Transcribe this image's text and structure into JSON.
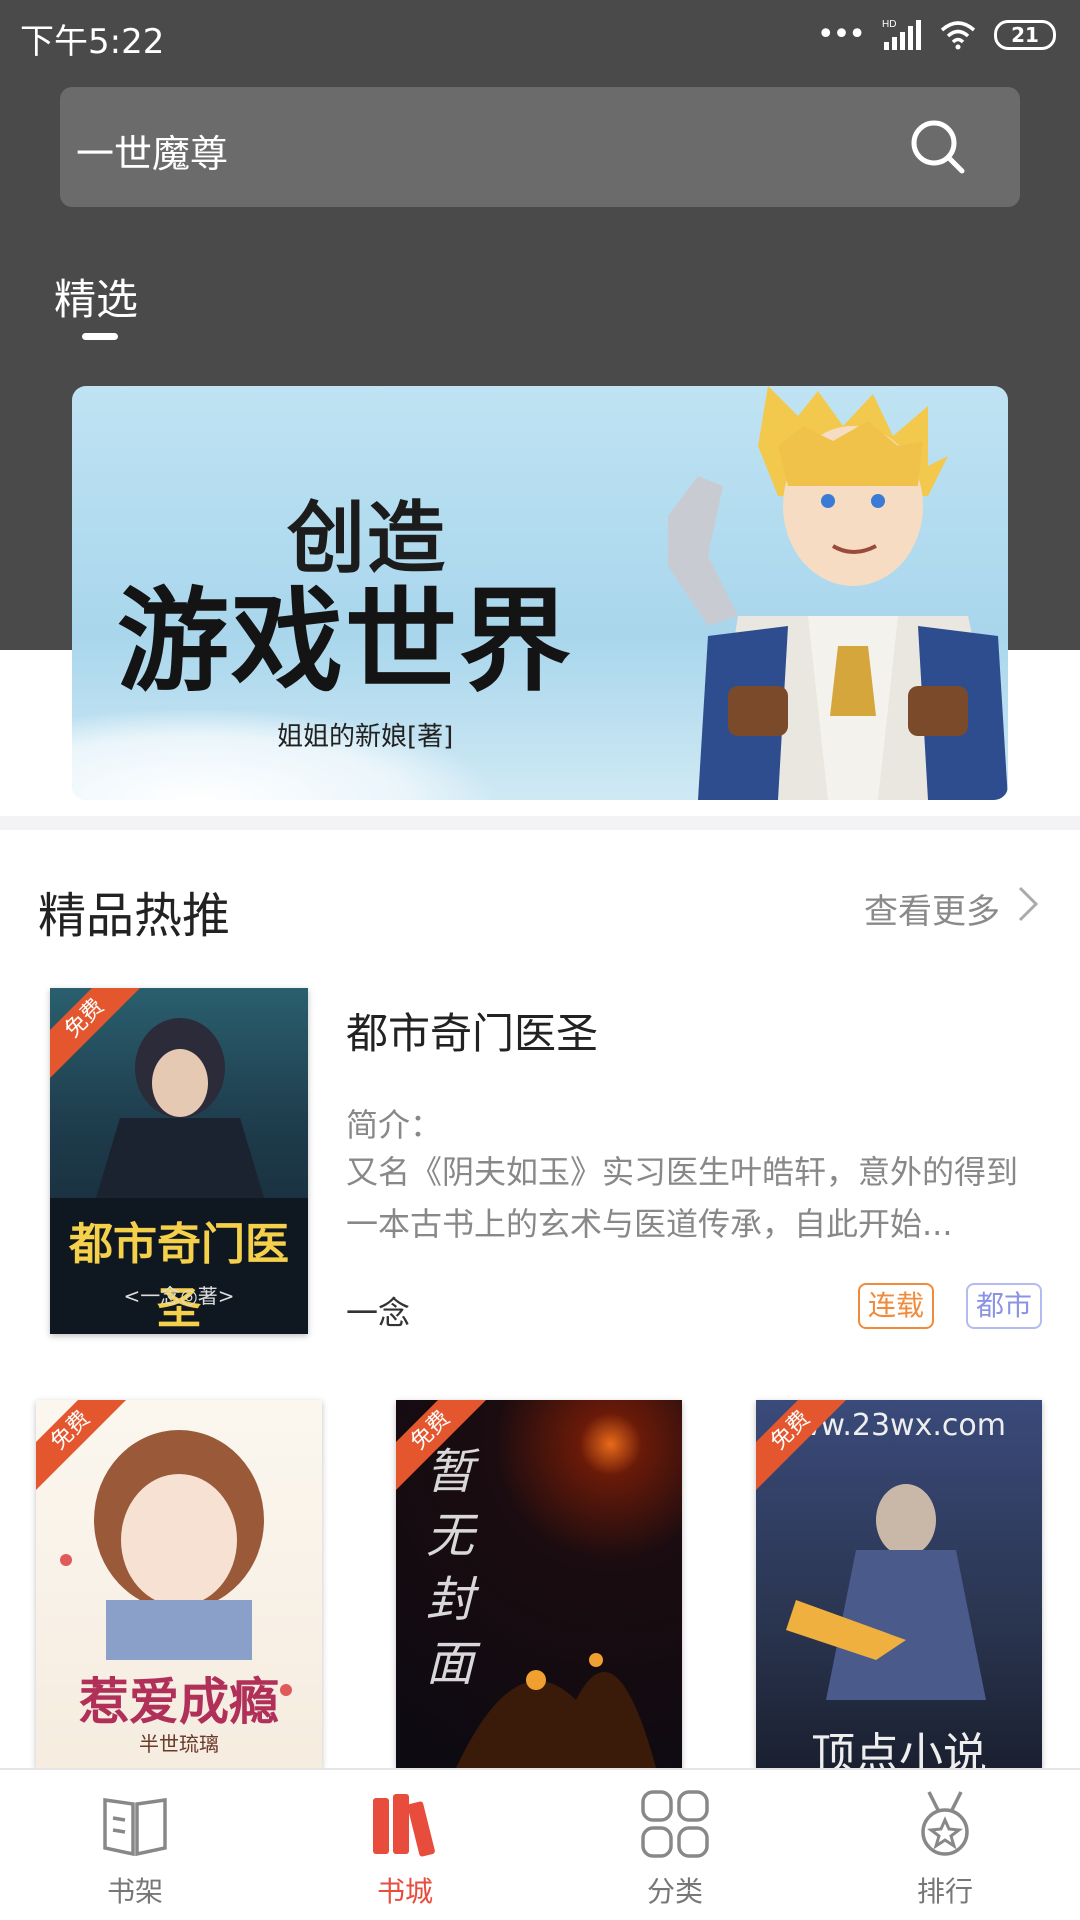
{
  "status_bar": {
    "time": "下午5:22",
    "battery": "21",
    "network_label": "HD"
  },
  "search": {
    "value": "一世魔尊",
    "icon": "search-icon"
  },
  "tabs": [
    {
      "label": "精选",
      "active": true
    }
  ],
  "banner": {
    "title_line1": "创造",
    "title_line2": "游戏世界",
    "author": "姐姐的新娘[著]"
  },
  "section": {
    "title": "精品热推",
    "see_more": "查看更多"
  },
  "featured_book": {
    "title": "都市奇门医圣",
    "intro_label": "简介：",
    "intro": "又名《阴夫如玉》实习医生叶皓轩，意外的得到一本古书上的玄术与医道传承，自此开始...",
    "author": "一念",
    "tags": [
      "连载",
      "都市"
    ],
    "badge": "免费",
    "cover_text": "都市奇门医圣",
    "cover_author": "<一念◎著>"
  },
  "grid_books": [
    {
      "badge": "免费",
      "cover_text": "惹爱成瘾",
      "cover_author": "半世琉璃"
    },
    {
      "badge": "免费",
      "cover_text": "暂无封面"
    },
    {
      "badge": "免费",
      "cover_text": "顶点小说",
      "cover_url_text": "ww.23wx.com"
    }
  ],
  "bottom_nav": [
    {
      "label": "书架",
      "icon": "book-open-icon",
      "active": false
    },
    {
      "label": "书城",
      "icon": "bookshelf-icon",
      "active": true
    },
    {
      "label": "分类",
      "icon": "grid-category-icon",
      "active": false
    },
    {
      "label": "排行",
      "icon": "medal-ranking-icon",
      "active": false
    }
  ],
  "colors": {
    "header_bg": "#4a4a4a",
    "accent": "#e74c3c",
    "badge": "#e4572e",
    "tag_serial": "#f08b3c",
    "tag_genre": "#8a93e6"
  }
}
